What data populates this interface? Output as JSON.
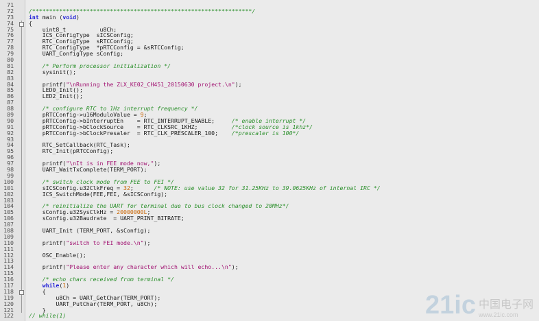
{
  "editor": {
    "colors": {
      "background": "#ebebeb",
      "keyword": "#1c1cd6",
      "comment": "#2a8f2a",
      "string": "#a01070",
      "number": "#c86400"
    },
    "lines": [
      {
        "n": "71",
        "tokens": []
      },
      {
        "n": "72",
        "tokens": [
          {
            "t": "cm",
            "v": "/*****************************************************************/"
          }
        ]
      },
      {
        "n": "73",
        "tokens": [
          {
            "t": "kw",
            "v": "int"
          },
          {
            "t": "tx",
            "v": " main ("
          },
          {
            "t": "kw",
            "v": "void"
          },
          {
            "t": "tx",
            "v": ")"
          }
        ]
      },
      {
        "n": "74",
        "tokens": [
          {
            "t": "tx",
            "v": "{"
          }
        ]
      },
      {
        "n": "75",
        "tokens": [
          {
            "t": "tx",
            "v": "    uint8_t          u8Ch;"
          }
        ]
      },
      {
        "n": "76",
        "tokens": [
          {
            "t": "tx",
            "v": "    ICS_ConfigType  sICSConfig;"
          }
        ]
      },
      {
        "n": "77",
        "tokens": [
          {
            "t": "tx",
            "v": "    RTC_ConfigType  sRTCConfig;"
          }
        ]
      },
      {
        "n": "78",
        "tokens": [
          {
            "t": "tx",
            "v": "    RTC_ConfigType  *pRTCConfig = &sRTCConfig;"
          }
        ]
      },
      {
        "n": "79",
        "tokens": [
          {
            "t": "tx",
            "v": "    UART_ConfigType sConfig;"
          }
        ]
      },
      {
        "n": "80",
        "tokens": []
      },
      {
        "n": "81",
        "tokens": [
          {
            "t": "tx",
            "v": "    "
          },
          {
            "t": "cm",
            "v": "/* Perform processor initialization */"
          }
        ]
      },
      {
        "n": "82",
        "tokens": [
          {
            "t": "tx",
            "v": "    sysinit();"
          }
        ]
      },
      {
        "n": "83",
        "tokens": []
      },
      {
        "n": "84",
        "tokens": [
          {
            "t": "tx",
            "v": "    printf("
          },
          {
            "t": "str",
            "v": "\"\\nRunning the ZLX_KE02_CH451_20150630 project.\\n\""
          },
          {
            "t": "tx",
            "v": ");"
          }
        ]
      },
      {
        "n": "85",
        "tokens": [
          {
            "t": "tx",
            "v": "    LED0_Init();"
          }
        ]
      },
      {
        "n": "86",
        "tokens": [
          {
            "t": "tx",
            "v": "    LED2_Init();"
          }
        ]
      },
      {
        "n": "87",
        "tokens": []
      },
      {
        "n": "88",
        "tokens": [
          {
            "t": "tx",
            "v": "    "
          },
          {
            "t": "cm",
            "v": "/* configure RTC to 1Hz interrupt frequency */"
          }
        ]
      },
      {
        "n": "89",
        "tokens": [
          {
            "t": "tx",
            "v": "    pRTCConfig->u16ModuloValue = "
          },
          {
            "t": "num",
            "v": "9"
          },
          {
            "t": "tx",
            "v": ";"
          }
        ]
      },
      {
        "n": "90",
        "tokens": [
          {
            "t": "tx",
            "v": "    pRTCConfig->bInterruptEn    = RTC_INTERRUPT_ENABLE;     "
          },
          {
            "t": "cm",
            "v": "/* enable interrupt */"
          }
        ]
      },
      {
        "n": "91",
        "tokens": [
          {
            "t": "tx",
            "v": "    pRTCConfig->bClockSource    = RTC_CLKSRC_1KHZ;          "
          },
          {
            "t": "cm",
            "v": "/*clock source is 1khz*/"
          }
        ]
      },
      {
        "n": "92",
        "tokens": [
          {
            "t": "tx",
            "v": "    pRTCConfig->bClockPresaler  = RTC_CLK_PRESCALER_100;    "
          },
          {
            "t": "cm",
            "v": "/*prescaler is 100*/"
          }
        ]
      },
      {
        "n": "93",
        "tokens": []
      },
      {
        "n": "94",
        "tokens": [
          {
            "t": "tx",
            "v": "    RTC_SetCallback(RTC_Task);"
          }
        ]
      },
      {
        "n": "95",
        "tokens": [
          {
            "t": "tx",
            "v": "    RTC_Init(pRTCConfig);"
          }
        ]
      },
      {
        "n": "96",
        "tokens": []
      },
      {
        "n": "97",
        "tokens": [
          {
            "t": "tx",
            "v": "    printf("
          },
          {
            "t": "str",
            "v": "\"\\nIt is in FEE mode now,\""
          },
          {
            "t": "tx",
            "v": ");"
          }
        ]
      },
      {
        "n": "98",
        "tokens": [
          {
            "t": "tx",
            "v": "    UART_WaitTxComplete(TERM_PORT);"
          }
        ]
      },
      {
        "n": "99",
        "tokens": []
      },
      {
        "n": "100",
        "tokens": [
          {
            "t": "tx",
            "v": "    "
          },
          {
            "t": "cm",
            "v": "/* switch clock mode from FEE to FEI */"
          }
        ]
      },
      {
        "n": "101",
        "tokens": [
          {
            "t": "tx",
            "v": "    sICSConfig.u32ClkFreq = "
          },
          {
            "t": "num",
            "v": "32"
          },
          {
            "t": "tx",
            "v": ";      "
          },
          {
            "t": "cm",
            "v": "/* NOTE: use value 32 for 31.25KHz to 39.0625KHz of internal IRC */"
          }
        ]
      },
      {
        "n": "102",
        "tokens": [
          {
            "t": "tx",
            "v": "    ICS_SwitchMode(FEE,FEI, &sICSConfig);"
          }
        ]
      },
      {
        "n": "103",
        "tokens": []
      },
      {
        "n": "104",
        "tokens": [
          {
            "t": "tx",
            "v": "    "
          },
          {
            "t": "cm",
            "v": "/* reinitialize the UART for terminal due to bus clock changed to 20MHz*/"
          }
        ]
      },
      {
        "n": "105",
        "tokens": [
          {
            "t": "tx",
            "v": "    sConfig.u32SysClkHz = "
          },
          {
            "t": "num",
            "v": "20000000L"
          },
          {
            "t": "tx",
            "v": ";"
          }
        ]
      },
      {
        "n": "106",
        "tokens": [
          {
            "t": "tx",
            "v": "    sConfig.u32Baudrate  = UART_PRINT_BITRATE;"
          }
        ]
      },
      {
        "n": "107",
        "tokens": []
      },
      {
        "n": "108",
        "tokens": [
          {
            "t": "tx",
            "v": "    UART_Init (TERM_PORT, &sConfig);"
          }
        ]
      },
      {
        "n": "109",
        "tokens": []
      },
      {
        "n": "110",
        "tokens": [
          {
            "t": "tx",
            "v": "    printf("
          },
          {
            "t": "str",
            "v": "\"switch to FEI mode.\\n\""
          },
          {
            "t": "tx",
            "v": ");"
          }
        ]
      },
      {
        "n": "111",
        "tokens": []
      },
      {
        "n": "112",
        "tokens": [
          {
            "t": "tx",
            "v": "    OSC_Enable();"
          }
        ]
      },
      {
        "n": "113",
        "tokens": []
      },
      {
        "n": "114",
        "tokens": [
          {
            "t": "tx",
            "v": "    printf("
          },
          {
            "t": "str",
            "v": "\"Please enter any character which will echo...\\n\""
          },
          {
            "t": "tx",
            "v": ");"
          }
        ]
      },
      {
        "n": "115",
        "tokens": []
      },
      {
        "n": "116",
        "tokens": [
          {
            "t": "tx",
            "v": "    "
          },
          {
            "t": "cm",
            "v": "/* echo chars received from terminal */"
          }
        ]
      },
      {
        "n": "117",
        "tokens": [
          {
            "t": "tx",
            "v": "    "
          },
          {
            "t": "kw",
            "v": "while"
          },
          {
            "t": "tx",
            "v": "("
          },
          {
            "t": "num",
            "v": "1"
          },
          {
            "t": "tx",
            "v": ")"
          }
        ]
      },
      {
        "n": "118",
        "tokens": [
          {
            "t": "tx",
            "v": "    {"
          }
        ]
      },
      {
        "n": "119",
        "tokens": [
          {
            "t": "tx",
            "v": "        u8Ch = UART_GetChar(TERM_PORT);"
          }
        ]
      },
      {
        "n": "120",
        "tokens": [
          {
            "t": "tx",
            "v": "        UART_PutChar(TERM_PORT, u8Ch);"
          }
        ]
      },
      {
        "n": "121",
        "tokens": [
          {
            "t": "tx",
            "v": "    }"
          }
        ]
      },
      {
        "n": "122",
        "tokens": [
          {
            "t": "cm",
            "v": "// while(1)"
          }
        ]
      }
    ]
  },
  "watermark": {
    "logo": "21ic",
    "cn": "中国电子网",
    "url": "www.21ic.com"
  }
}
